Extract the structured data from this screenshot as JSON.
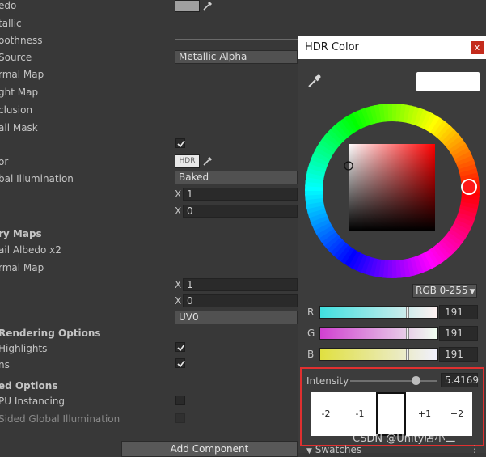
{
  "inspector": {
    "labels": {
      "albedo": "edo",
      "metallic": "tallic",
      "smoothness": "oothness",
      "source": "Source",
      "normal_map": "rmal Map",
      "height_map": "ght Map",
      "occlusion": "clusion",
      "detail_mask": "ail Mask",
      "emission_color": "or",
      "global_illumination": "bal Illumination",
      "secondary_maps": "ry Maps",
      "detail_albedo": "ail Albedo x2",
      "secondary_normal_map": "rmal Map",
      "rendering_options": "Rendering Options",
      "specular_highlights": "Highlights",
      "reflections": "ns",
      "advanced_options": "ed Options",
      "gpu_instancing": "PU Instancing",
      "double_sided_gi": "Sided Global Illumination"
    },
    "hdr_badge": "HDR",
    "source_dropdown": "Metallic Alpha",
    "gi_dropdown": "Baked",
    "tiling": {
      "x_label": "X",
      "x_value": "1"
    },
    "offset": {
      "x_label": "X",
      "x_value": "0"
    },
    "tiling2": {
      "x_label": "X",
      "x_value": "1"
    },
    "offset2": {
      "x_label": "X",
      "x_value": "0"
    },
    "uv_dropdown": "UV0",
    "add_component": "Add Component"
  },
  "hdr_color": {
    "title": "HDR Color",
    "close": "x",
    "mode_dropdown": "RGB 0-255",
    "channels": [
      {
        "label": "R",
        "value": "191",
        "fraction": 0.749
      },
      {
        "label": "G",
        "value": "191",
        "fraction": 0.749
      },
      {
        "label": "B",
        "value": "191",
        "fraction": 0.749
      }
    ],
    "intensity_label": "Intensity",
    "intensity_value": "5.4169",
    "swatches_label": "Swatches",
    "exposure_swatches": [
      "-2",
      "-1",
      "",
      "+1",
      "+2"
    ]
  },
  "watermark": "CSDN @Unity店小二",
  "colors": {
    "panel_bg": "#3c3c3c",
    "highlight_border": "#e03030",
    "hue_marker": "#ff1a1a"
  }
}
